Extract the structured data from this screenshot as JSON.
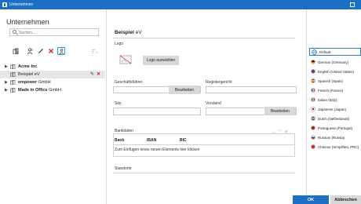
{
  "window": {
    "title": "Unternehmen"
  },
  "left": {
    "heading": "Unternehmen",
    "search_placeholder": "Suchen...",
    "toolbar": {
      "add_company_icon": "building-add-icon",
      "add_person_icon": "person-add-icon",
      "pencil_icon": "pencil-icon",
      "delete_icon": "delete-icon",
      "move_icon": "move-person-icon",
      "sort_icon": "sort-icon"
    },
    "tree": [
      {
        "label": "Acme Inc",
        "expanded": false,
        "selected": false
      },
      {
        "label": "Beispiel eV",
        "expanded": false,
        "selected": true
      },
      {
        "label_bold": "empower",
        "label_rest": " GmbH",
        "expanded": false,
        "selected": false
      },
      {
        "label_bold": "Made in Office",
        "label_rest": " GmbH",
        "expanded": false,
        "selected": false
      }
    ]
  },
  "center": {
    "title_bold": "Beispiel",
    "title_rest": " eV",
    "logo_label": "Logo",
    "logo_button": "Logo auswählen",
    "geschaeftsfuehrer_label": "Geschäftsführer",
    "edit_button": "Bearbeiten",
    "registergericht_label": "Registergericht",
    "sitz_label": "Sitz",
    "vorstand_label": "Vorstand",
    "vorstand_edit_button": "Bearbeiten",
    "bankdaten_label": "Bankdaten",
    "bank_columns": [
      "Bank",
      "IBAN",
      "BIC"
    ],
    "bank_add_hint": "Zum Einfügen eines neuen Elements hier klicken",
    "standorte_label": "Standorte"
  },
  "right": {
    "languages": [
      {
        "label": "Default",
        "icon": "globe-icon"
      },
      {
        "label": "German (Germany)",
        "color": "#000000"
      },
      {
        "label": "English (United States)",
        "color": "#3c3b6e"
      },
      {
        "label": "Spanish (Spain)",
        "color": "#c60b1e"
      },
      {
        "label": "French (France)",
        "color": "#0055a4"
      },
      {
        "label": "Italian (Italy)",
        "color": "#009246"
      },
      {
        "label": "Japanese (Japan)",
        "color": "#bc002d"
      },
      {
        "label": "Dutch (Netherlands)",
        "color": "#21468b"
      },
      {
        "label": "Portuguese (Portugal)",
        "color": "#006600"
      },
      {
        "label": "Russian (Russia)",
        "color": "#0039a6"
      },
      {
        "label": "Chinese (Simplified, PRC)",
        "color": "#de2910"
      }
    ]
  },
  "footer": {
    "ok": "OK",
    "cancel": "Abbrechen"
  },
  "colors": {
    "accent": "#1c6fc5",
    "highlight": "#1e9fe3",
    "delete": "#d02020"
  }
}
